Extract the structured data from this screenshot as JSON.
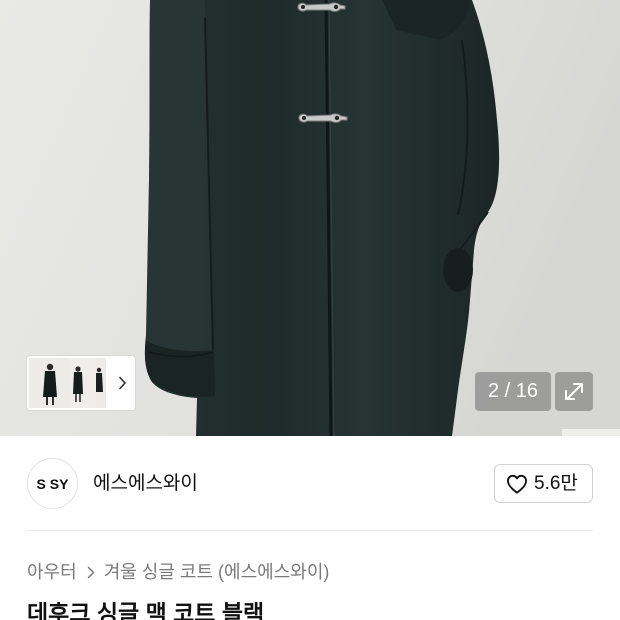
{
  "theme": {
    "text_primary": "#111111",
    "text_secondary": "#7a7a7a",
    "border": "#d2d2d2",
    "divider": "#ebebeb",
    "coat_color": "#1f2b2a"
  },
  "gallery": {
    "counter": "2 / 16",
    "thumbnail_more_icon": "chevron-right-icon",
    "expand_icon": "expand-icon"
  },
  "brand": {
    "logo_text": "S SY",
    "name": "에스에스와이"
  },
  "like": {
    "icon": "heart-outline-icon",
    "count": "5.6만"
  },
  "breadcrumb": {
    "items": [
      {
        "label": "아우터"
      },
      {
        "label": "겨울 싱글 코트 (에스에스와이)"
      }
    ],
    "separator_icon": "chevron-right-icon"
  },
  "product": {
    "title": "데후크 싱글 맥 코트 블랙"
  }
}
